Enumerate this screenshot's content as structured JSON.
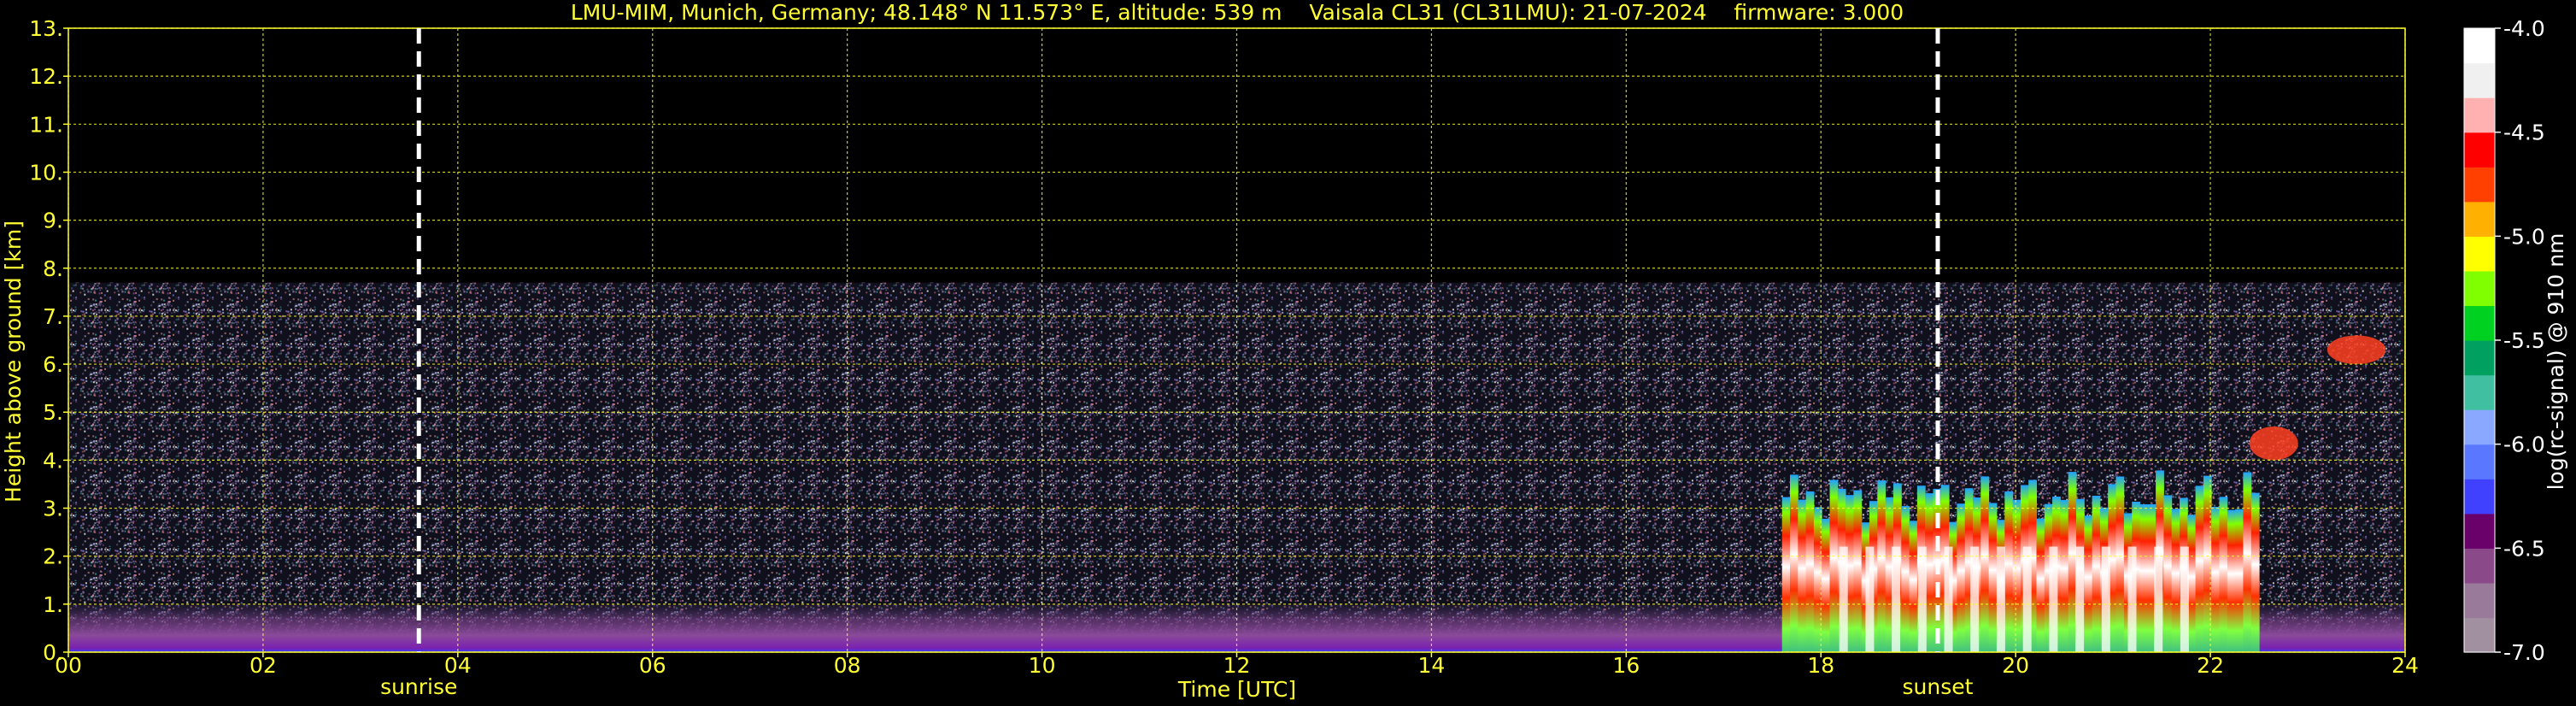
{
  "title": "LMU-MIM, Munich, Germany; 48.148° N 11.573° E, altitude: 539 m    Vaisala CL31 (CL31LMU): 21-07-2024    firmware: 3.000",
  "xlabel": "Time [UTC]",
  "ylabel": "Height above ground [km]",
  "colorbar": {
    "label": "log(rc-signal) @ 910 nm",
    "ticks": [
      "-4.0",
      "-4.5",
      "-5.0",
      "-5.5",
      "-6.0",
      "-6.5",
      "-7.0"
    ],
    "tick_values": [
      -4.0,
      -4.5,
      -5.0,
      -5.5,
      -6.0,
      -6.5,
      -7.0
    ],
    "range": [
      -7.0,
      -4.0
    ],
    "colors": [
      "#a090a0",
      "#9a7a9a",
      "#8a4a8a",
      "#6a006a",
      "#4040ff",
      "#5a78ff",
      "#8aa8ff",
      "#40c0a0",
      "#00a060",
      "#00d020",
      "#80ff00",
      "#ffff00",
      "#ffb000",
      "#ff4000",
      "#ff0000",
      "#ffb0b0",
      "#f0f0f0",
      "#ffffff"
    ]
  },
  "colors": {
    "text": "#ffff33",
    "grid": "#ffff33",
    "background": "#000000",
    "marker": "#ffffff"
  },
  "chart_data": {
    "type": "heatmap",
    "title": "LMU-MIM, Munich, Germany; 48.148° N 11.573° E, altitude: 539 m    Vaisala CL31 (CL31LMU): 21-07-2024    firmware: 3.000",
    "xlabel": "Time [UTC]",
    "ylabel": "Height above ground [km]",
    "xlim": [
      0,
      24
    ],
    "ylim": [
      0,
      13
    ],
    "x_ticks": [
      0,
      2,
      4,
      6,
      8,
      10,
      12,
      14,
      16,
      18,
      20,
      22,
      24
    ],
    "x_tick_labels": [
      "00",
      "02",
      "04",
      "06",
      "08",
      "10",
      "12",
      "14",
      "16",
      "18",
      "20",
      "22",
      "24"
    ],
    "y_ticks": [
      0,
      1,
      2,
      3,
      4,
      5,
      6,
      7,
      8,
      9,
      10,
      11,
      12,
      13
    ],
    "y_tick_labels": [
      "0.",
      "1.",
      "2.",
      "3.",
      "4.",
      "5.",
      "6.",
      "7.",
      "8.",
      "9.",
      "10.",
      "11.",
      "12.",
      "13."
    ],
    "grid": true,
    "signal_top_km": 7.7,
    "markers": [
      {
        "label": "sunrise",
        "time": 3.6
      },
      {
        "label": "sunset",
        "time": 19.2
      }
    ],
    "features": [
      {
        "name": "boundary-layer",
        "start": 0,
        "end": 24,
        "top_km": 1.0
      },
      {
        "name": "cloud-deck",
        "start": 17.6,
        "end": 22.5,
        "base_km": 0.0,
        "top_km": 3.8
      },
      {
        "name": "high-cloud",
        "start": 23.2,
        "end": 23.8,
        "base_km": 6.0,
        "top_km": 6.6
      },
      {
        "name": "mid-cloud",
        "start": 22.4,
        "end": 22.9,
        "base_km": 4.0,
        "top_km": 4.7
      }
    ]
  }
}
